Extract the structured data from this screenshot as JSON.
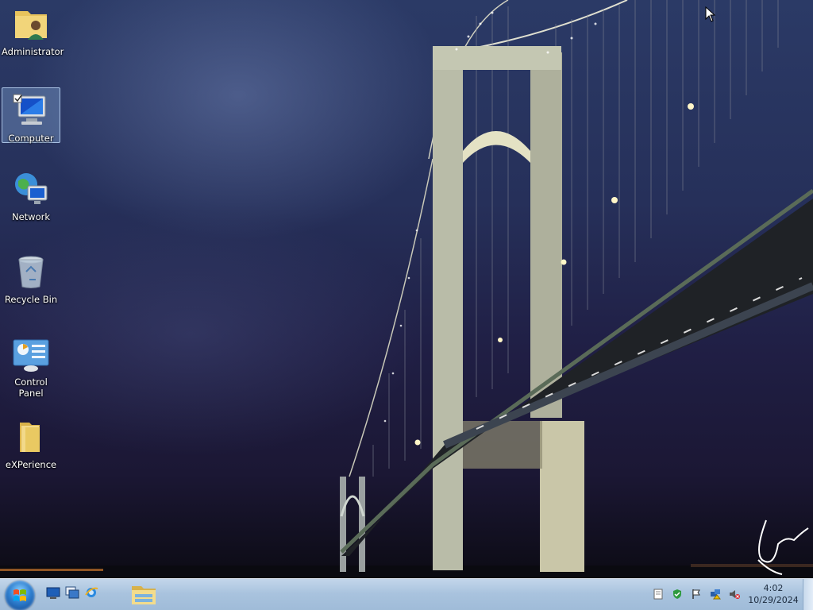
{
  "desktop": {
    "icons": [
      {
        "label": "Administrator",
        "icon": "user-folder-icon"
      },
      {
        "label": "Computer",
        "icon": "computer-icon"
      },
      {
        "label": "Network",
        "icon": "network-icon"
      },
      {
        "label": "Recycle Bin",
        "icon": "recycle-bin-icon"
      },
      {
        "label": "Control Panel",
        "icon": "control-panel-icon"
      },
      {
        "label": "eXPerience",
        "icon": "folder-icon"
      }
    ],
    "selected_icon": "Computer"
  },
  "taskbar": {
    "start": "start-orb-icon",
    "quick_launch": [
      "show-desktop-icon",
      "switch-windows-icon",
      "internet-explorer-icon"
    ],
    "pinned": [
      "windows-explorer-icon"
    ],
    "tray": [
      "notes-icon",
      "security-shield-icon",
      "action-center-flag-icon",
      "network-tray-icon",
      "volume-muted-icon"
    ],
    "time": "4:02",
    "date": "10/29/2024"
  },
  "colors": {
    "taskbar_top": "#c3d6ea",
    "taskbar_bottom": "#9fbbd8",
    "sky_top": "#2b3a66",
    "sky_bottom": "#1b1734"
  }
}
